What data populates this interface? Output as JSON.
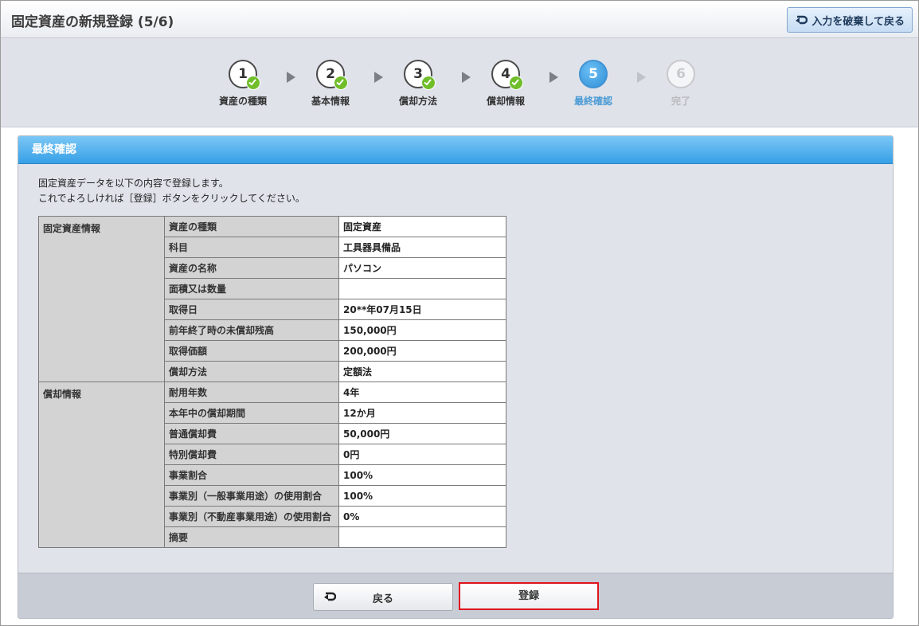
{
  "header": {
    "title": "固定資産の新規登録 (5/6)",
    "discard_label": "入力を破棄して戻る"
  },
  "stepper": {
    "steps": [
      {
        "number": "1",
        "label": "資産の種類",
        "state": "done"
      },
      {
        "number": "2",
        "label": "基本情報",
        "state": "done"
      },
      {
        "number": "3",
        "label": "償却方法",
        "state": "done"
      },
      {
        "number": "4",
        "label": "償却情報",
        "state": "done"
      },
      {
        "number": "5",
        "label": "最終確認",
        "state": "current"
      },
      {
        "number": "6",
        "label": "完了",
        "state": "pending"
      }
    ]
  },
  "panel": {
    "title": "最終確認",
    "intro_line1": "固定資産データを以下の内容で登録します。",
    "intro_line2": "これでよろしければ［登録］ボタンをクリックしてください。"
  },
  "table": {
    "group1": "固定資産情報",
    "group2": "償却情報",
    "rows": [
      {
        "item": "資産の種類",
        "value": "固定資産"
      },
      {
        "item": "科目",
        "value": "工具器具備品"
      },
      {
        "item": "資産の名称",
        "value": "パソコン"
      },
      {
        "item": "面積又は数量",
        "value": ""
      },
      {
        "item": "取得日",
        "value": "20**年07月15日"
      },
      {
        "item": "前年終了時の未償却残高",
        "value": "150,000円"
      },
      {
        "item": "取得価額",
        "value": "200,000円"
      },
      {
        "item": "償却方法",
        "value": "定額法"
      },
      {
        "item": "耐用年数",
        "value": "4年"
      },
      {
        "item": "本年中の償却期間",
        "value": "12か月"
      },
      {
        "item": "普通償却費",
        "value": "50,000円"
      },
      {
        "item": "特別償却費",
        "value": "0円"
      },
      {
        "item": "事業割合",
        "value": "100%"
      },
      {
        "item": "事業別（一般事業用途）の使用割合",
        "value": "100%"
      },
      {
        "item": "事業別（不動産事業用途）の使用割合",
        "value": "0%"
      },
      {
        "item": "摘要",
        "value": ""
      }
    ]
  },
  "footer": {
    "back_label": "戻る",
    "register_label": "登録"
  },
  "colors": {
    "accent_blue": "#37a0e6",
    "check_green": "#6fbe2a",
    "highlight_red": "#e0141e"
  }
}
